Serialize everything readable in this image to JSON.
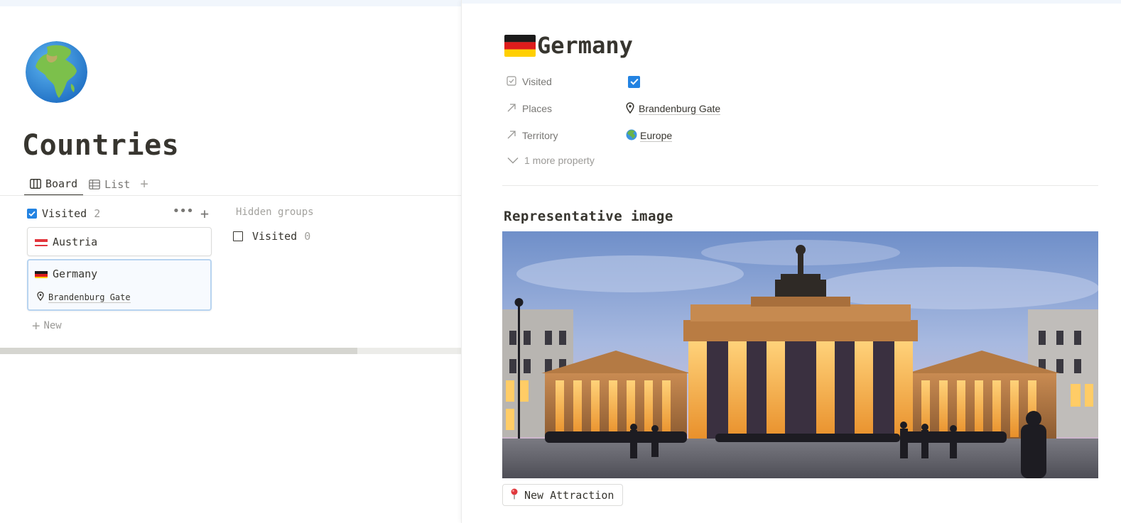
{
  "database": {
    "title": "Countries",
    "icon": "globe-africa-icon",
    "views": [
      {
        "label": "Board",
        "icon": "board-icon",
        "active": true
      },
      {
        "label": "List",
        "icon": "table-icon",
        "active": false
      }
    ],
    "add_view": "+",
    "board": {
      "group": {
        "label": "Visited",
        "count": "2",
        "checked": true,
        "cards": [
          {
            "title": "Austria",
            "flag": "austria-flag"
          },
          {
            "title": "Germany",
            "flag": "germany-flag",
            "place": "Brandenburg Gate",
            "selected": true
          }
        ]
      },
      "new_label": "New",
      "hidden_groups": {
        "label": "Hidden groups",
        "items": [
          {
            "label": "Visited",
            "count": "0",
            "checked": false
          }
        ]
      }
    }
  },
  "peek": {
    "title": "Germany",
    "title_flag": "germany-flag",
    "properties": [
      {
        "name": "Visited",
        "icon": "checkbox-icon",
        "type": "checkbox",
        "checked": true
      },
      {
        "name": "Places",
        "icon": "relation-arrow-icon",
        "value": "Brandenburg Gate",
        "value_icon": "pin-icon"
      },
      {
        "name": "Territory",
        "icon": "relation-arrow-icon",
        "value": "Europe",
        "value_icon": "globe-icon"
      }
    ],
    "more_properties": "1 more property",
    "section_heading": "Representative image",
    "image_subject": "brandenburg-gate-photo",
    "attraction_button": "New Attraction",
    "attraction_icon": "round-pushpin-icon"
  },
  "colors": {
    "accent_blue": "#2383e2",
    "text": "#37352f",
    "muted": "#787774",
    "selected_border": "#b8d4f0"
  }
}
